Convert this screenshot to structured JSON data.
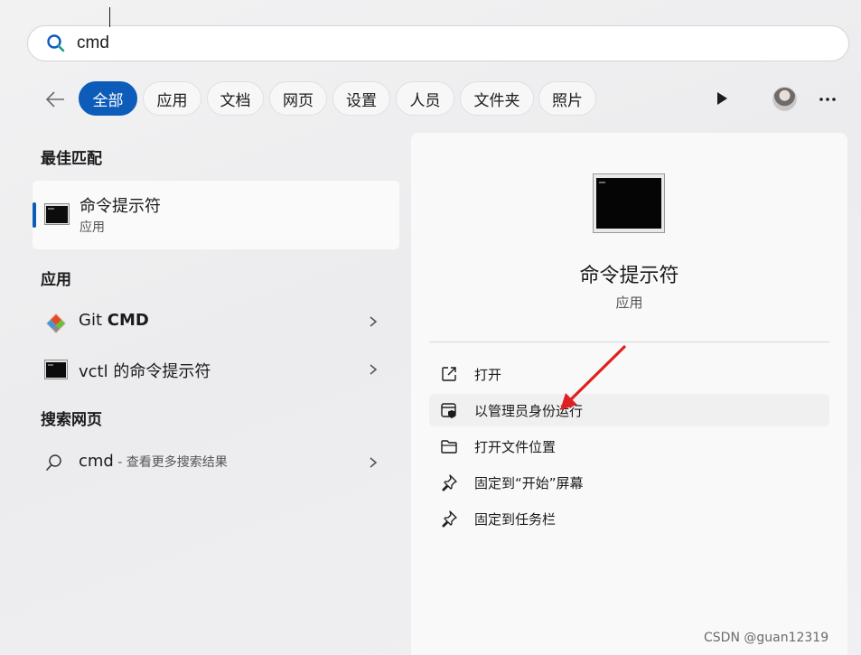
{
  "search": {
    "value": "cmd"
  },
  "tabs": [
    {
      "label": "全部",
      "active": true
    },
    {
      "label": "应用"
    },
    {
      "label": "文档"
    },
    {
      "label": "网页"
    },
    {
      "label": "设置"
    },
    {
      "label": "人员"
    },
    {
      "label": "文件夹"
    },
    {
      "label": "照片"
    }
  ],
  "left": {
    "best_match_title": "最佳匹配",
    "best_match": {
      "title": "命令提示符",
      "subtitle": "应用"
    },
    "apps_title": "应用",
    "apps": [
      {
        "prefix": "Git ",
        "bold": "CMD"
      },
      {
        "prefix": "vctl 的命令提示符",
        "bold": ""
      }
    ],
    "web_title": "搜索网页",
    "web": {
      "query": "cmd",
      "hint": " - 查看更多搜索结果"
    }
  },
  "detail": {
    "title": "命令提示符",
    "subtitle": "应用",
    "actions": [
      {
        "label": "打开",
        "icon": "open-external-icon"
      },
      {
        "label": "以管理员身份运行",
        "icon": "shield-admin-icon"
      },
      {
        "label": "打开文件位置",
        "icon": "folder-icon"
      },
      {
        "label": "固定到“开始”屏幕",
        "icon": "pin-icon"
      },
      {
        "label": "固定到任务栏",
        "icon": "pin-icon"
      }
    ]
  },
  "watermark": "CSDN @guan12319",
  "colors": {
    "accent": "#0d5cba",
    "annotation_arrow": "#e02020"
  }
}
